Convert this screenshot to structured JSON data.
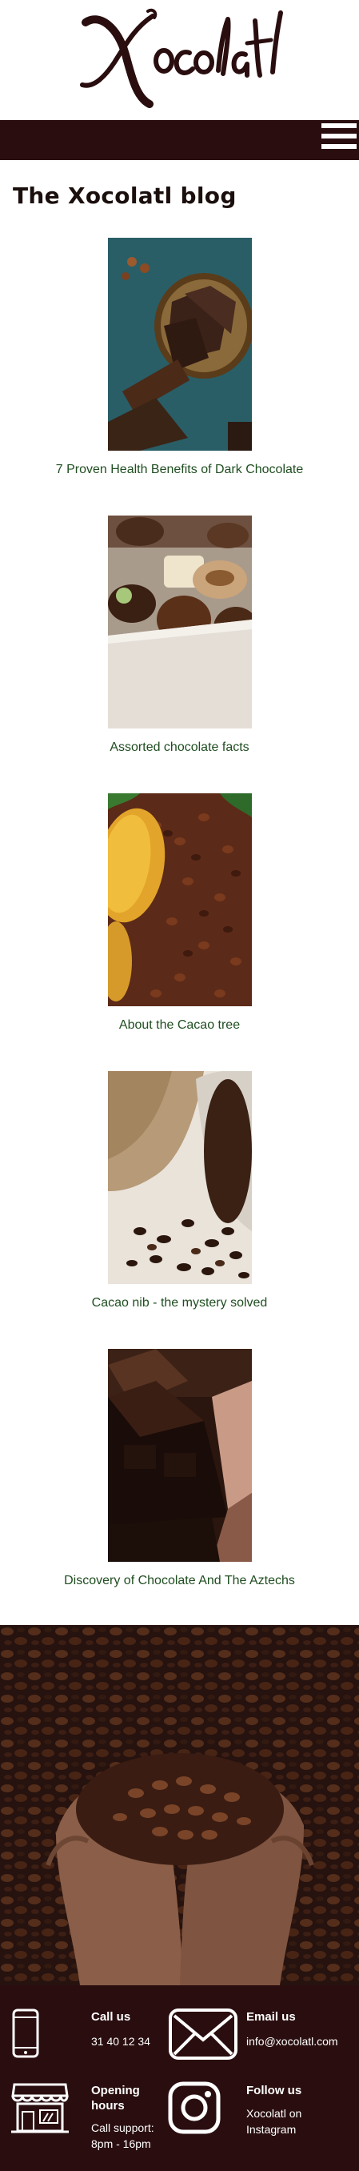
{
  "brand": {
    "logo_text": "Xocolatl"
  },
  "nav": {
    "menu_icon": "hamburger-menu-icon"
  },
  "blog": {
    "title": "The Xocolatl blog",
    "posts": [
      {
        "title": "7 Proven Health Benefits of Dark Chocolate",
        "image": "dark-chocolate-chunks-photo"
      },
      {
        "title": "Assorted chocolate facts",
        "image": "assorted-pralines-photo"
      },
      {
        "title": "About the Cacao tree",
        "image": "cacao-pods-and-beans-photo"
      },
      {
        "title": "Cacao nib - the mystery solved",
        "image": "cacao-nibs-in-sack-photo"
      },
      {
        "title": "Discovery of Chocolate And The Aztechs",
        "image": "chocolate-bar-pieces-photo"
      }
    ]
  },
  "hero": {
    "image": "hands-holding-cacao-beans-photo"
  },
  "footer": {
    "call": {
      "heading": "Call us",
      "value": "31 40 12 34",
      "icon": "phone-icon"
    },
    "email": {
      "heading": "Email us",
      "value": "info@xocolatl.com",
      "icon": "envelope-icon"
    },
    "hours": {
      "heading_line1": "Opening",
      "heading_line2": "hours",
      "value_line1": "Call support:",
      "value_line2": "8pm - 16pm",
      "icon": "storefront-icon"
    },
    "follow": {
      "heading": "Follow us",
      "value_line1": "Xocolatl on",
      "value_line2": "Instagram",
      "icon": "instagram-icon"
    }
  },
  "colors": {
    "dark_brown": "#2a0e0f",
    "link_green": "#1f4e20",
    "white": "#ffffff"
  }
}
